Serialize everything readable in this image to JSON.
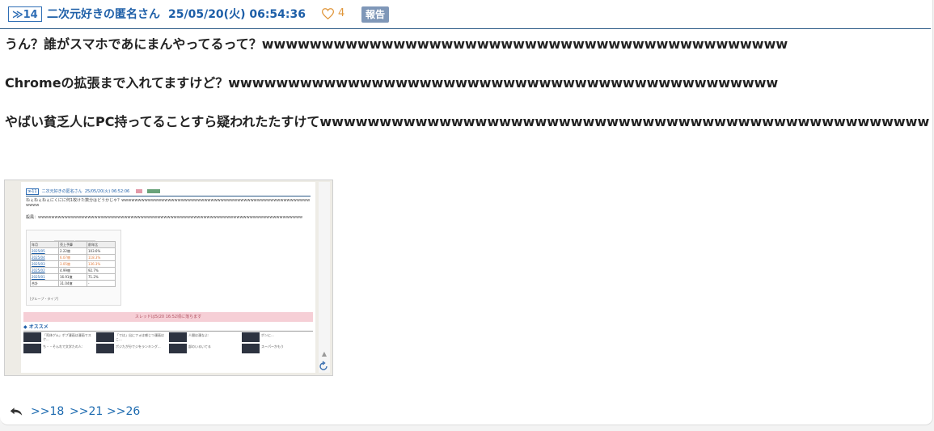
{
  "post": {
    "number": "≫14",
    "author": "二次元好きの匿名さん",
    "date": "25/05/20(火) 06:54:36",
    "likes": "4",
    "report_label": "報告",
    "lines": [
      "うん？誰がスマホであにまんやってるって？wwwwwwwwwwwwwwwwwwwwwwwwwwwwwwwwwwwwwwwwwwww",
      "Chromeの拡張まで入れてますけど？wwwwwwwwwwwwwwwwwwwwwwwwwwwwwwwwwwwwwwwwwwwwww",
      "やばい貧乏人にPC持ってることすら疑われたたすけてwwwwwwwwwwwwwwwwwwwwwwwwwwwwwwwwwwwwwwwwwwwwwwwwwww"
    ],
    "anchors": [
      ">>18",
      ">>21",
      ">>26"
    ]
  },
  "thumbnail": {
    "header_num": "≫11",
    "header_author": "二次元好きの匿名さん",
    "header_date": "25/05/20(火) 06:52:06",
    "line1": "ねぇねぇねぇにくにに何1枚けた数分はどうかじゃ？wwwwwwwwwwwwwwwwwwwwwwwwwwwwwwwwwwwwwwwwwwwwwwwwwwwwwwwwwwwww",
    "line2": "殺風：wwwwwwwwwwwwwwwwwwwwwwwwwwwwwwwwwwwwwwwwwwwwwwwwwwwwwwwwwwwwwwwwwwwwwwwwwwwwwwww",
    "tabs": [
      "2025",
      "",
      ""
    ],
    "table": {
      "head": [
        "年月",
        "売上予算",
        "前年比"
      ],
      "rows": [
        [
          "2025/05",
          "2.22億",
          "103.6%"
        ],
        [
          "2025/04",
          "6.07億",
          "118.3%"
        ],
        [
          "2025/03",
          "3.05億",
          "136.3%"
        ],
        [
          "2025/02",
          "4.99億",
          "92.7%"
        ],
        [
          "2025/01",
          "16.91億",
          "71.2%"
        ],
        [
          "合計",
          "31.04億",
          "-"
        ]
      ]
    },
    "caption": "[グループ・タイプ]",
    "pink_notice": "スレッドは5/20 16:52頃に落ちます",
    "rec_label": "オススメ",
    "cards": [
      "「死体ゲム」ポプ漫画は漫画でスク...",
      "「では」出にフォは感じつ漫画はこ...",
      "人間は漫なよ:",
      "ポンに...",
      "ち・・そんれで文学たの人:",
      "ポジたが分でジをランキング...",
      "部のいるいてる",
      "スーパーかもう"
    ]
  }
}
